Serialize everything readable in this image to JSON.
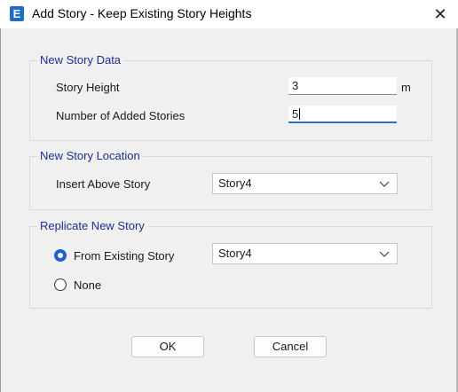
{
  "window": {
    "title": "Add Story - Keep Existing Story Heights",
    "app_icon_letter": "E"
  },
  "new_story_data": {
    "legend": "New Story Data",
    "story_height_label": "Story Height",
    "story_height_value": "3",
    "story_height_unit": "m",
    "added_stories_label": "Number of Added Stories",
    "added_stories_value": "5"
  },
  "new_story_location": {
    "legend": "New Story Location",
    "insert_above_label": "Insert Above Story",
    "insert_above_value": "Story4"
  },
  "replicate_new_story": {
    "legend": "Replicate New Story",
    "from_existing_label": "From Existing Story",
    "from_existing_selected": true,
    "from_existing_value": "Story4",
    "none_label": "None",
    "none_selected": false
  },
  "buttons": {
    "ok": "OK",
    "cancel": "Cancel"
  }
}
